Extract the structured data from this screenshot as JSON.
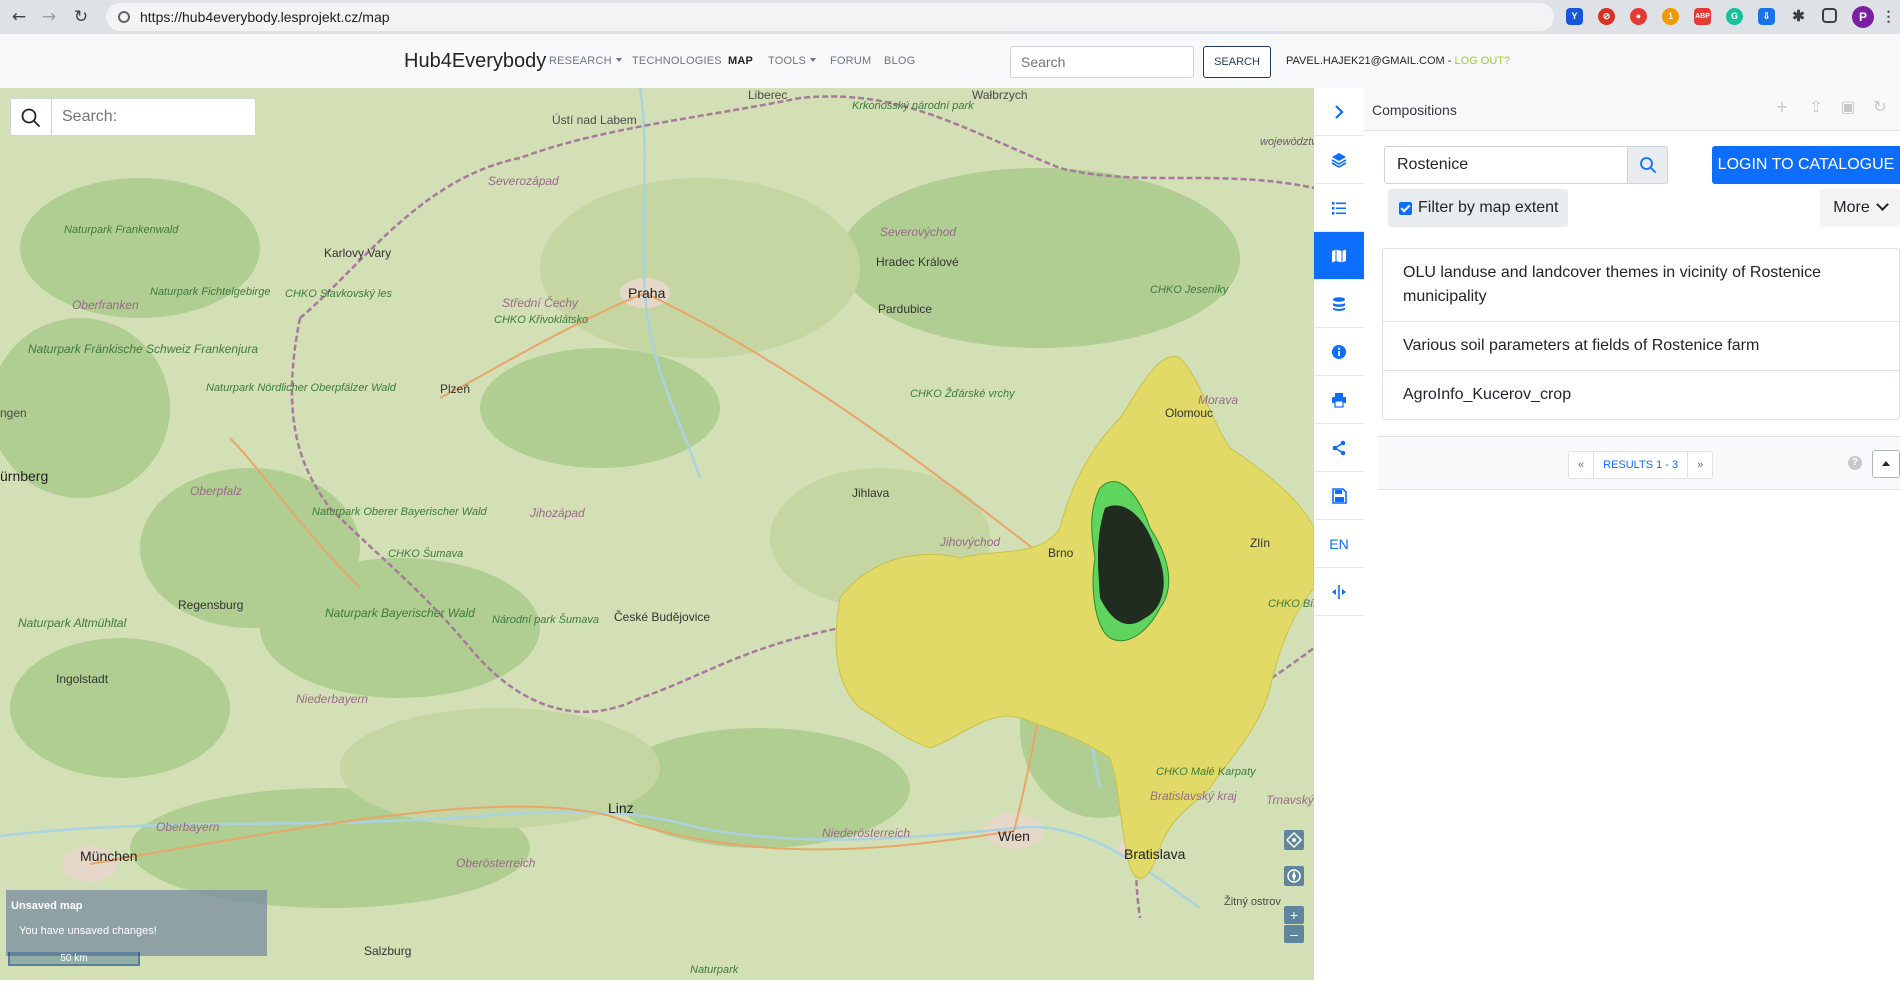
{
  "browser": {
    "url": "https://hub4everybody.lesprojekt.cz/map",
    "profile_initial": "P",
    "extensions": [
      {
        "name": "v-extension",
        "color": "#1a56db",
        "text": "Y"
      },
      {
        "name": "block-extension",
        "color": "#d93025",
        "text": "⊘"
      },
      {
        "name": "red-extension",
        "color": "#e53935",
        "text": "●"
      },
      {
        "name": "orange-badge-extension",
        "color": "#f29900",
        "text": "1"
      },
      {
        "name": "adblock-extension",
        "color": "#e53935",
        "text": "ABP"
      },
      {
        "name": "grammarly-extension",
        "color": "#15c39a",
        "text": "G"
      },
      {
        "name": "download-extension",
        "color": "#1a73e8",
        "text": "⇩"
      }
    ]
  },
  "navbar": {
    "brand": "Hub4Everybody",
    "items": [
      {
        "label": "RESEARCH",
        "dropdown": true
      },
      {
        "label": "TECHNOLOGIES",
        "dropdown": false
      },
      {
        "label": "MAP",
        "dropdown": false,
        "active": true
      },
      {
        "label": "TOOLS",
        "dropdown": true
      },
      {
        "label": "FORUM",
        "dropdown": false
      },
      {
        "label": "BLOG",
        "dropdown": false
      }
    ],
    "search_placeholder": "Search",
    "search_button": "SEARCH",
    "user_email": "PAVEL.HAJEK21@GMAIL.COM",
    "separator": " - ",
    "logout": "LOG OUT?"
  },
  "map": {
    "search_placeholder": "Search:",
    "labels": {
      "liberec": "Liberec",
      "walbrzych": "Wałbrzych",
      "usti": "Ústí nad Labem",
      "krkonossky": "Krkonošský národní park",
      "vojevodstvi": "województwo opolskie",
      "severozapad": "Severozápad",
      "severovychod": "Severovýchod",
      "karlovy_vary": "Karlovy Vary",
      "hradec": "Hradec Králové",
      "naturpark_frankenwald": "Naturpark Frankenwald",
      "chko_slavkovsky": "CHKO Slavkovský les",
      "praha": "Praha",
      "stredni_cechy": "Střední Čechy",
      "chko_krivoklatsko": "CHKO Křivoklátsko",
      "pardubice": "Pardubice",
      "chko_jeseniky": "CHKO Jeseníky",
      "oberfranken": "Oberfranken",
      "naturpark_fichtelgebirge": "Naturpark Fichtelgebirge",
      "naturpark_frankische": "Naturpark Fränkische Schweiz Frankenjura",
      "plzen": "Plzeň",
      "naturpark_nordlicher": "Naturpark Nördlicher Oberpfälzer Wald",
      "chko_zdarske": "CHKO Žďárské vrchy",
      "morava": "Morava",
      "olomouc": "Olomouc",
      "ngen": "ngen",
      "nurnberg": "ürnberg",
      "oberpfalz": "Oberpfalz",
      "jihlava": "Jihlava",
      "naturpark_oberer": "Naturpark Oberer Bayerischer Wald",
      "jihozapad": "Jihozápad",
      "jihovychod": "Jihovýchod",
      "chko_sumava": "CHKO Šumava",
      "brno": "Brno",
      "zlin": "Zlín",
      "regensburg": "Regensburg",
      "naturpark_altmuhltal": "Naturpark Altmühltal",
      "naturpark_bayerischer": "Naturpark Bayerischer Wald",
      "narodni_park_sumava": "Národní park Šumava",
      "ceske_budejovice": "České Budějovice",
      "chko_bile_karpaty": "CHKO Bílé Karpaty",
      "ingolstadt": "Ingolstadt",
      "niederbayern": "Niederbayern",
      "linz": "Linz",
      "chko_male_karpaty": "CHKO Malé Karpaty",
      "bratislavsky": "Bratislavský kraj",
      "trnavsky": "Trnavský kraj",
      "oberbayern": "Oberbayern",
      "niederosterreich": "Niederösterreich",
      "wien": "Wien",
      "bratislava": "Bratislava",
      "munchen": "München",
      "oberosterreich": "Oberösterreich",
      "zitny_ostrov": "Žitný ostrov",
      "salzburg": "Salzburg",
      "naturpark_bottom": "Naturpark"
    },
    "unsaved_title": "Unsaved map",
    "unsaved_message": "You have unsaved changes!",
    "scale": "50 km",
    "colors": {
      "layer_yellow": "#e3dc6a",
      "layer_green": "#5fd45f",
      "layer_dark": "#1a1a1a"
    }
  },
  "toolbar": {
    "items": [
      {
        "name": "toggle-panel-button",
        "icon": "chevron-right-icon"
      },
      {
        "name": "layer-manager-button",
        "icon": "layers-icon"
      },
      {
        "name": "legend-button",
        "icon": "list-icon"
      },
      {
        "name": "compositions-button",
        "icon": "map-icon",
        "active": true
      },
      {
        "name": "datasource-button",
        "icon": "database-icon"
      },
      {
        "name": "info-button",
        "icon": "info-icon"
      },
      {
        "name": "print-button",
        "icon": "print-icon"
      },
      {
        "name": "share-button",
        "icon": "share-icon"
      },
      {
        "name": "save-button",
        "icon": "save-icon"
      },
      {
        "name": "language-button",
        "icon": "",
        "label": "EN"
      },
      {
        "name": "measure-button",
        "icon": "compress-icon"
      }
    ]
  },
  "panel": {
    "title": "Compositions",
    "search_value": "Rostenice",
    "login_button": "LOGIN TO CATALOGUE",
    "filter_label": "Filter by map extent",
    "filter_checked": true,
    "more_label": "More",
    "results": [
      "OLU landuse and landcover themes in vicinity of Rostenice municipality",
      "Various soil parameters at fields of Rostenice farm",
      "AgroInfo_Kucerov_crop"
    ],
    "pager": {
      "prev": "«",
      "label": "RESULTS 1 - 3",
      "next": "»"
    },
    "help": "?"
  },
  "colors": {
    "primary": "#0d6efd",
    "logout": "#9acd32",
    "navy": "#1f3a5f"
  }
}
